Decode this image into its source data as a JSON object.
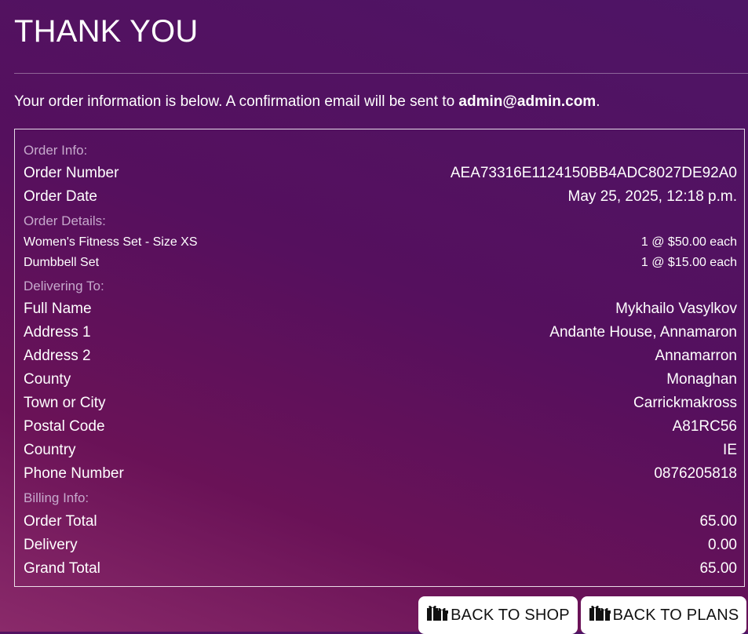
{
  "page": {
    "title": "THANK YOU",
    "intro_text": "Your order information is below. A confirmation email will be sent to ",
    "email": "admin@admin.com",
    "intro_end": "."
  },
  "order_info": {
    "heading": "Order Info:",
    "number_label": "Order Number",
    "number_value": "AEA73316E1124150BB4ADC8027DE92A0",
    "date_label": "Order Date",
    "date_value": "May 25, 2025, 12:18 p.m."
  },
  "order_details": {
    "heading": "Order Details:",
    "items": [
      {
        "name": "Women's Fitness Set - Size XS",
        "qty_price": "1 @ $50.00 each"
      },
      {
        "name": "Dumbbell Set",
        "qty_price": "1 @ $15.00 each"
      }
    ]
  },
  "delivering_to": {
    "heading": "Delivering To:",
    "full_name_label": "Full Name",
    "full_name": "Mykhailo Vasylkov",
    "address1_label": "Address 1",
    "address1": "Andante House, Annamaron",
    "address2_label": "Address 2",
    "address2": "Annamarron",
    "county_label": "County",
    "county": "Monaghan",
    "town_label": "Town or City",
    "town": "Carrickmakross",
    "postal_label": "Postal Code",
    "postal": "A81RC56",
    "country_label": "Country",
    "country": "IE",
    "phone_label": "Phone Number",
    "phone": "0876205818"
  },
  "billing": {
    "heading": "Billing Info:",
    "order_total_label": "Order Total",
    "order_total": "65.00",
    "delivery_label": "Delivery",
    "delivery": "0.00",
    "grand_total_label": "Grand Total",
    "grand_total": "65.00"
  },
  "buttons": {
    "shop": {
      "label": "BACK TO SHOP",
      "icon": "gifts-icon"
    },
    "plans": {
      "label": "BACK TO PLANS",
      "icon": "gifts-icon"
    }
  }
}
